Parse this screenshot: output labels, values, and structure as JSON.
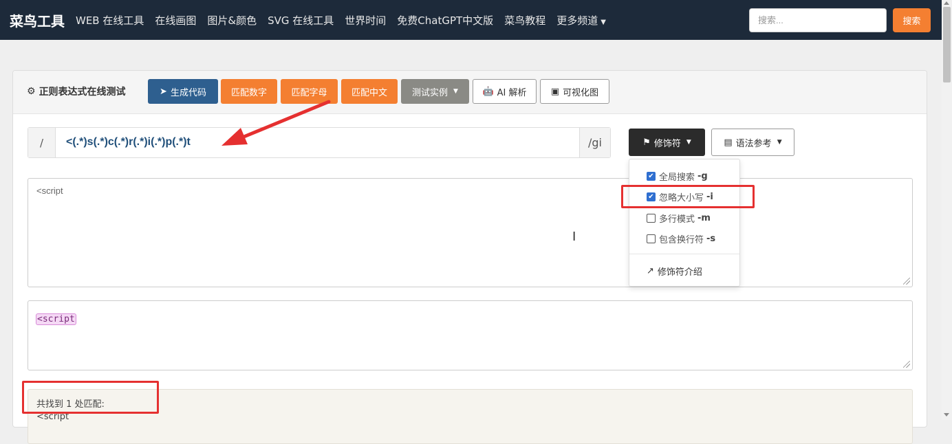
{
  "navbar": {
    "brand": "菜鸟工具",
    "links": [
      "WEB 在线工具",
      "在线画图",
      "图片&颜色",
      "SVG 在线工具",
      "世界时间",
      "免费ChatGPT中文版",
      "菜鸟教程",
      "更多频道"
    ],
    "search_placeholder": "搜索...",
    "search_button": "搜索"
  },
  "panel": {
    "title": "正则表达式在线测试",
    "buttons": {
      "generate": "生成代码",
      "match_digits": "匹配数字",
      "match_letters": "匹配字母",
      "match_chinese": "匹配中文",
      "examples": "测试实例",
      "ai": "AI 解析",
      "visualize": "可视化图"
    }
  },
  "regex": {
    "open_slash": "/",
    "pattern": "<(.*)s(.*)c(.*)r(.*)i(.*)p(.*)t",
    "flags": "/gi"
  },
  "modifier_button": "修饰符",
  "syntax_button": "语法参考",
  "modifiers_menu": {
    "items": [
      {
        "label": "全局搜索",
        "flag": "-g",
        "checked": true
      },
      {
        "label": "忽略大小写",
        "flag": "-i",
        "checked": true
      },
      {
        "label": "多行模式",
        "flag": "-m",
        "checked": false
      },
      {
        "label": "包含换行符",
        "flag": "-s",
        "checked": false
      }
    ],
    "link": "修饰符介绍"
  },
  "test_text": "<script",
  "highlighted_text": "<script",
  "result": {
    "count_text": "共找到 1 处匹配:",
    "first_match": "<script"
  },
  "colors": {
    "navbar": "#1d2a3a",
    "accent_orange": "#f47f31",
    "primary_blue": "#2e5f8f",
    "annotation_red": "#e53030"
  }
}
